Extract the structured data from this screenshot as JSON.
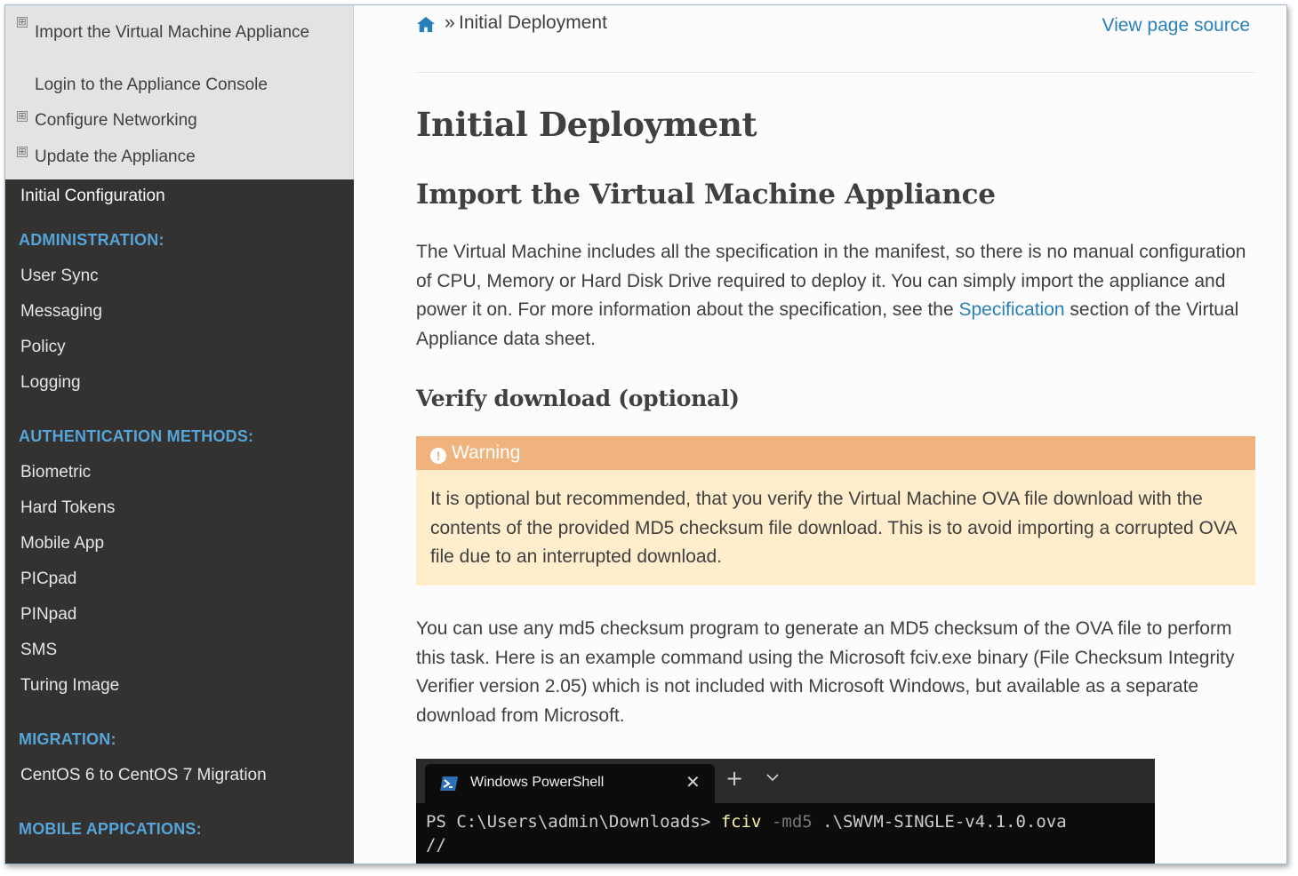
{
  "sidebar": {
    "sub_items": [
      {
        "label": "Import the Virtual Machine Appliance",
        "expandable": true
      },
      {
        "label": "Login to the Appliance Console",
        "expandable": false
      },
      {
        "label": "Configure Networking",
        "expandable": true
      },
      {
        "label": "Update the Appliance",
        "expandable": true
      }
    ],
    "toggle_glyph": "⊞",
    "current_item": "Initial Configuration",
    "sections": [
      {
        "caption": "ADMINISTRATION:",
        "items": [
          "User Sync",
          "Messaging",
          "Policy",
          "Logging"
        ]
      },
      {
        "caption": "AUTHENTICATION METHODS:",
        "items": [
          "Biometric",
          "Hard Tokens",
          "Mobile App",
          "PICpad",
          "PINpad",
          "SMS",
          "Turing Image"
        ]
      },
      {
        "caption": "MIGRATION:",
        "items": [
          "CentOS 6 to CentOS 7 Migration"
        ]
      },
      {
        "caption": "MOBILE APPICATIONS:",
        "items": []
      }
    ]
  },
  "breadcrumb": {
    "home_icon": "home-icon",
    "separator": "»",
    "current": "Initial Deployment",
    "view_source": "View page source"
  },
  "content": {
    "title": "Initial Deployment",
    "section_title": "Import the Virtual Machine Appliance",
    "intro_before_link": "The Virtual Machine includes all the specification in the manifest, so there is no manual configuration of CPU, Memory or Hard Disk Drive required to deploy it. You can simply import the appliance and power it on. For more information about the specification, see the ",
    "intro_link": "Specification",
    "intro_after_link": " section of the Virtual Appliance data sheet.",
    "subsection_title": "Verify download (optional)",
    "warning": {
      "title": "Warning",
      "icon": "exclamation-icon",
      "body": "It is optional but recommended, that you verify the Virtual Machine OVA file download with the contents of the provided MD5 checksum file download. This is to avoid importing a corrupted OVA file due to an interrupted download."
    },
    "paragraph2": "You can use any md5 checksum program to generate an MD5 checksum of the OVA file to perform this task. Here is an example command using the Microsoft fciv.exe binary (File Checksum Integrity Verifier version 2.05) which is not included with Microsoft Windows, but available as a separate download from Microsoft."
  },
  "terminal": {
    "tab_title": "Windows PowerShell",
    "close_glyph": "✕",
    "new_tab_glyph": "+",
    "prompt": "PS C:\\Users\\admin\\Downloads> ",
    "command": "fciv",
    "flag": " -md5",
    "argument": " .\\SWVM-SINGLE-v4.1.0.ova",
    "output_line1": "//"
  },
  "colors": {
    "sidebar_bg": "#343131",
    "section_caption": "#55a5d9",
    "link": "#2980b9",
    "warning_title_bg": "#f0b37e",
    "warning_body_bg": "#ffedcc",
    "terminal_bg": "#0c0c0c"
  }
}
